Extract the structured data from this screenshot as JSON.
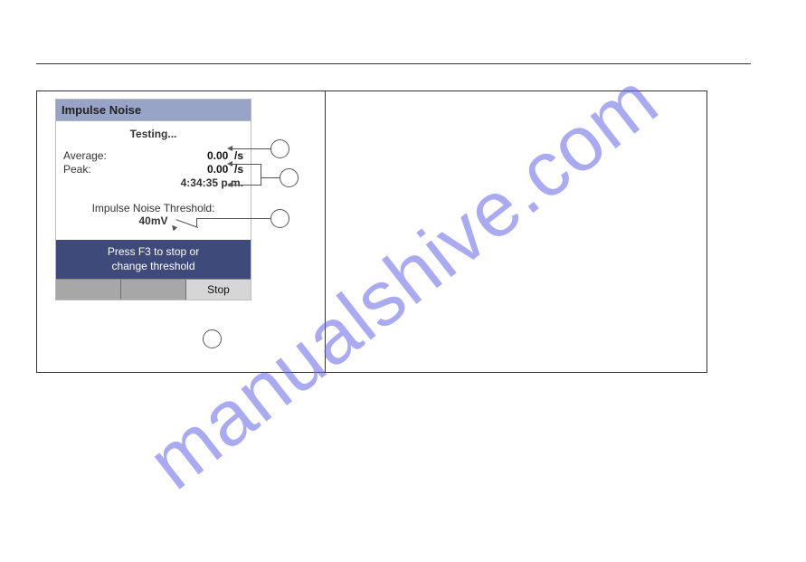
{
  "watermark": "manualshive.com",
  "panel": {
    "title": "Impulse Noise",
    "status": "Testing...",
    "average_label": "Average:",
    "average_value": "0.00  /s",
    "peak_label": "Peak:",
    "peak_value": "0.00  /s",
    "time": "4:34:35 p.m.",
    "threshold_label": "Impulse Noise Threshold:",
    "threshold_value": "40mV",
    "hint_line1": "Press F3 to stop or",
    "hint_line2": "change threshold",
    "key3": "Stop"
  }
}
